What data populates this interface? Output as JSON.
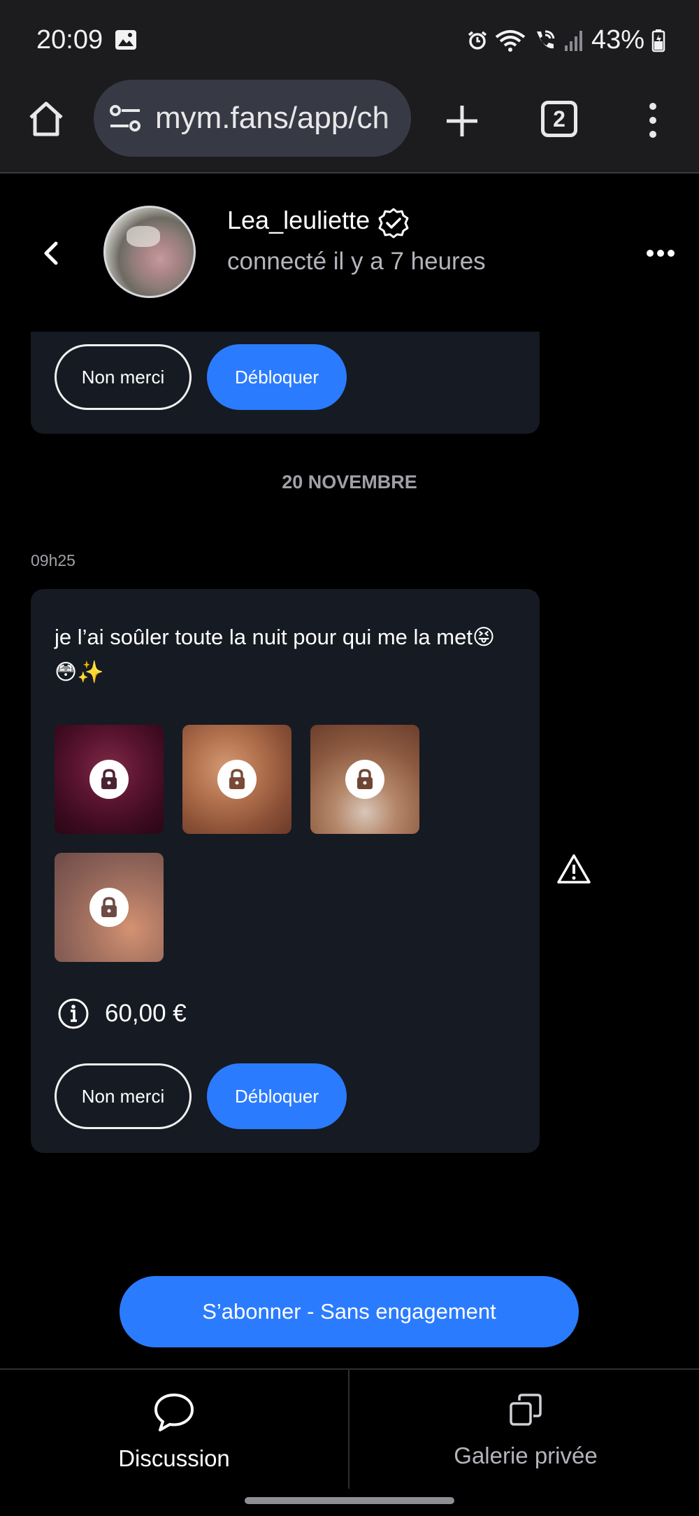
{
  "status_bar": {
    "time": "20:09",
    "battery": "43%",
    "icons": [
      "image-icon",
      "alarm-icon",
      "wifi-icon",
      "wifi-call-icon",
      "signal-icon",
      "battery-icon"
    ]
  },
  "browser": {
    "url": "mym.fans/app/ch",
    "tab_count": "2"
  },
  "chat": {
    "user_name": "Lea_leuliette",
    "user_status": "connecté il y a 7 heures"
  },
  "card_top": {
    "decline_label": "Non merci",
    "unlock_label": "Débloquer"
  },
  "date_separator": "20 NOVEMBRE",
  "message": {
    "time": "09h25",
    "text": "je l’ai soûler toute la nuit pour qui me la met😝😳✨",
    "locked_media_count": 4,
    "price": "60,00 €",
    "decline_label": "Non merci",
    "unlock_label": "Débloquer"
  },
  "subscribe_label": "S’abonner - Sans engagement",
  "bottom_tabs": {
    "discussion": "Discussion",
    "gallery": "Galerie privée"
  },
  "colors": {
    "accent": "#2b7bff",
    "card_bg": "#161a22",
    "background": "#000000"
  }
}
